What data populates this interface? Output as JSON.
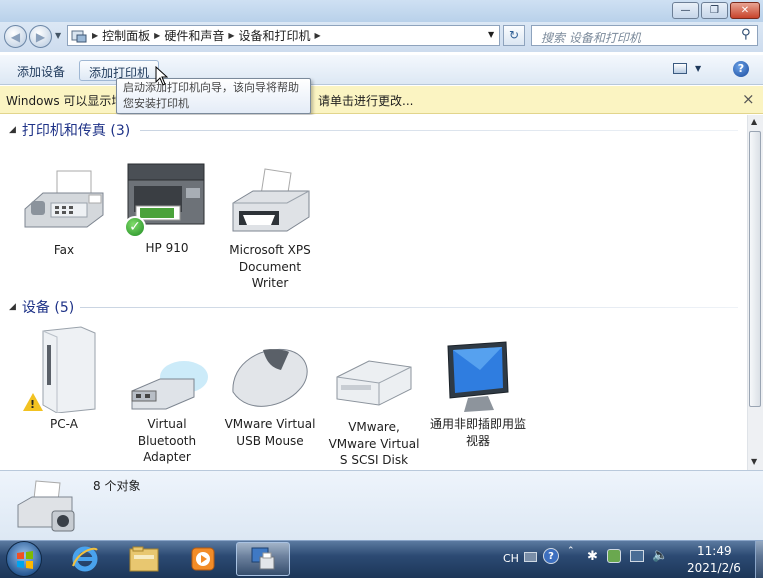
{
  "window": {
    "minimize": "—",
    "maximize": "❐",
    "close": "✕"
  },
  "address": {
    "segments": [
      "控制面板",
      "硬件和声音",
      "设备和打印机"
    ],
    "search_placeholder": "搜索 设备和打印机"
  },
  "commandbar": {
    "add_device": "添加设备",
    "add_printer": "添加打印机"
  },
  "infobar": {
    "text_left": "Windows 可以显示增",
    "text_right": "请单击进行更改...",
    "close": "×"
  },
  "tooltip": {
    "text": "启动添加打印机向导，该向导将帮助您安装打印机"
  },
  "groups": [
    {
      "title": "打印机和传真 (3)",
      "items": [
        {
          "label": "Fax",
          "icon": "fax-icon"
        },
        {
          "label": "HP 910",
          "icon": "multifunction-printer-icon",
          "default": true
        },
        {
          "label": "Microsoft XPS Document Writer",
          "icon": "printer-icon"
        }
      ]
    },
    {
      "title": "设备 (5)",
      "items": [
        {
          "label": "PC-A",
          "icon": "computer-tower-icon",
          "warning": true
        },
        {
          "label": "Virtual Bluetooth Adapter",
          "icon": "usb-bluetooth-icon"
        },
        {
          "label": "VMware Virtual USB Mouse",
          "icon": "mouse-icon"
        },
        {
          "label": "VMware, VMware Virtual S SCSI Disk",
          "icon": "disk-drive-icon"
        },
        {
          "label": "通用非即插即用监视器",
          "icon": "monitor-icon"
        }
      ]
    }
  ],
  "details": {
    "count": "8 个对象"
  },
  "taskbar": {
    "lang": "CH",
    "time": "11:49",
    "date": "2021/2/6"
  },
  "colors": {
    "accent": "#1e3287",
    "infobar": "#fbf4c2",
    "taskbar": "#2c4a73"
  }
}
